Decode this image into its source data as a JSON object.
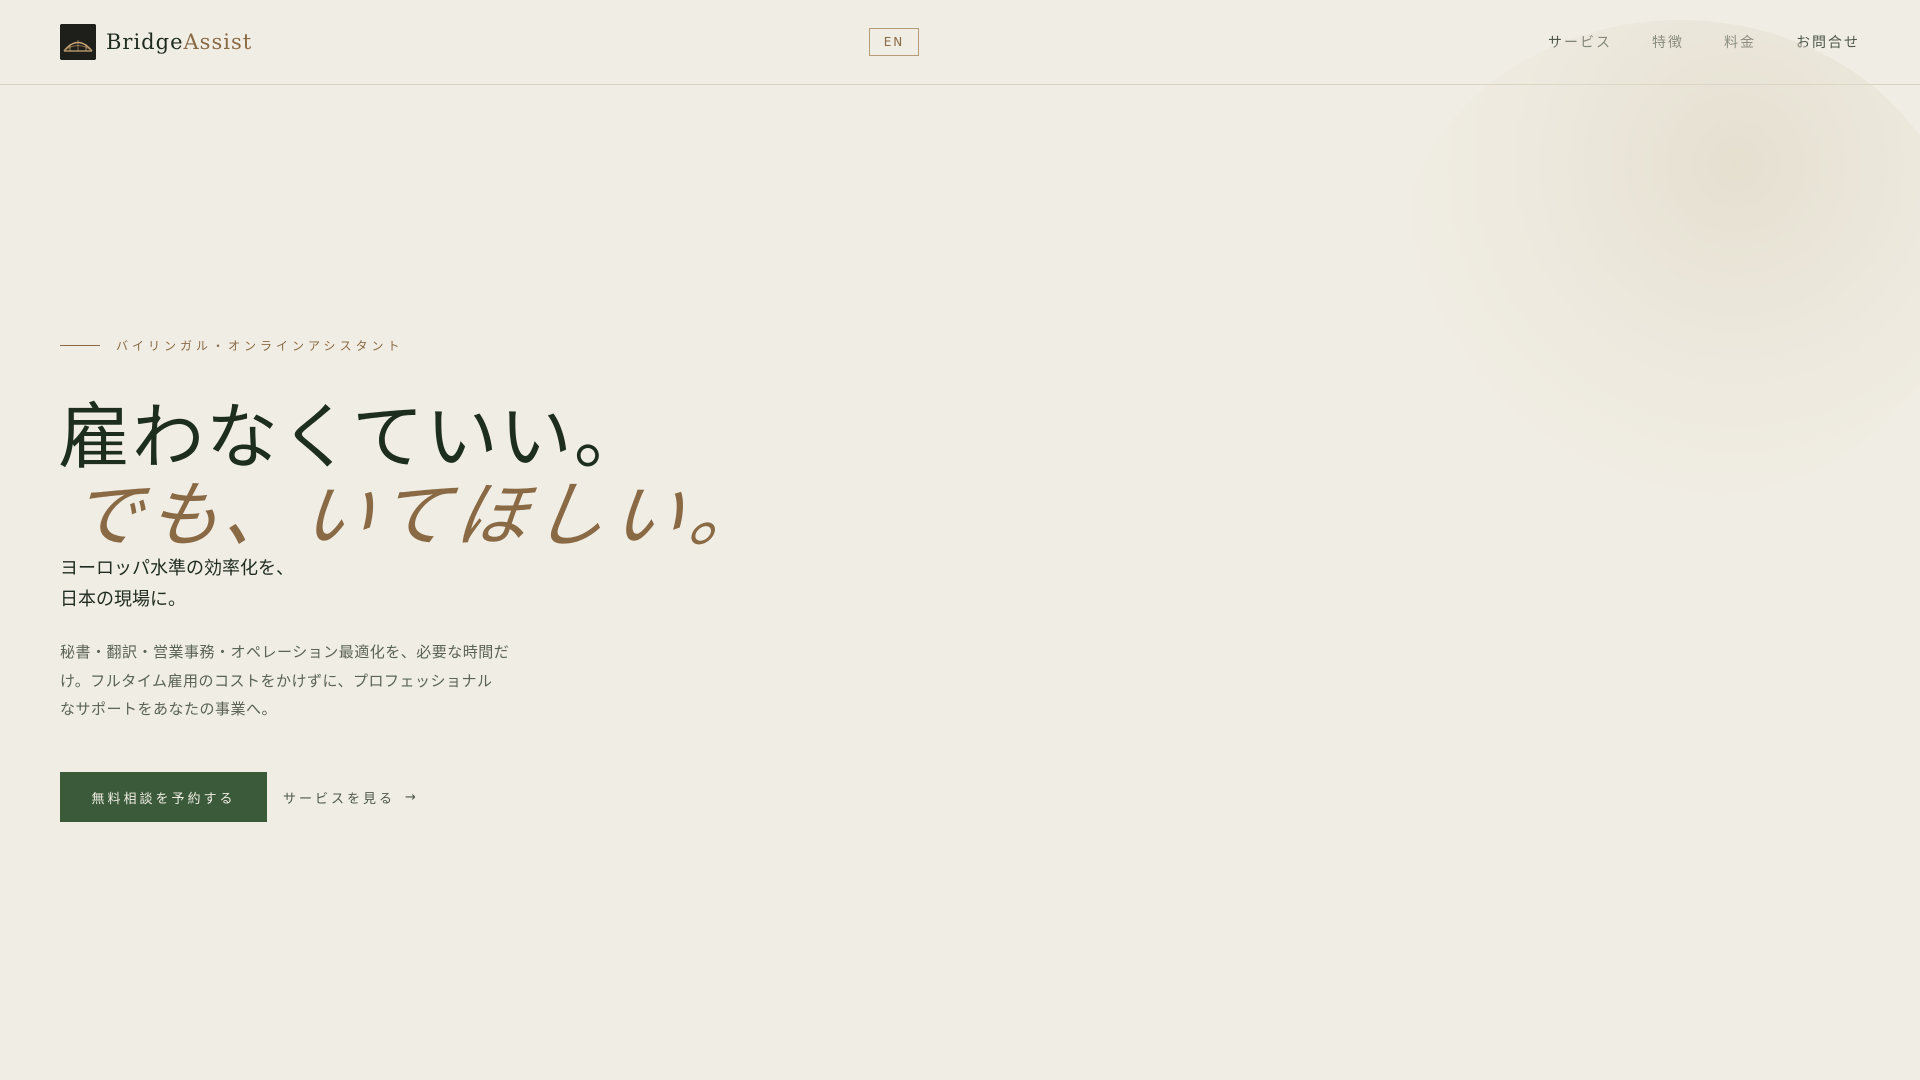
{
  "header": {
    "logo": {
      "icon": "bridge-logo-icon",
      "name_primary": "Bridge",
      "name_accent": "Assist"
    },
    "language_toggle": "EN",
    "nav": [
      {
        "label": "サービス"
      },
      {
        "label": "特徴"
      },
      {
        "label": "料金"
      },
      {
        "label": "お問合せ"
      }
    ]
  },
  "hero": {
    "eyebrow": "バイリンガル・オンラインアシスタント",
    "headline_line1": "雇わなくていい。",
    "headline_line2": "でも、いてほしい。",
    "subhead_line1": "ヨーロッパ水準の効率化を、",
    "subhead_line2": "日本の現場に。",
    "description_line1": "秘書・翻訳・営業事務・オペレーション最適化を、必要な時間だ",
    "description_line2": "け。フルタイム雇用のコストをかけずに、プロフェッショナル",
    "description_line3": "なサポートをあなたの事業へ。",
    "primary_cta": "無料相談を予約する",
    "secondary_cta": "サービスを見る",
    "secondary_cta_icon": "arrow-right-icon"
  },
  "colors": {
    "background": "#f0ede4",
    "primary_green": "#3b5a39",
    "accent_brown": "#8a6a45",
    "heading_dark": "#1d2e1e"
  }
}
